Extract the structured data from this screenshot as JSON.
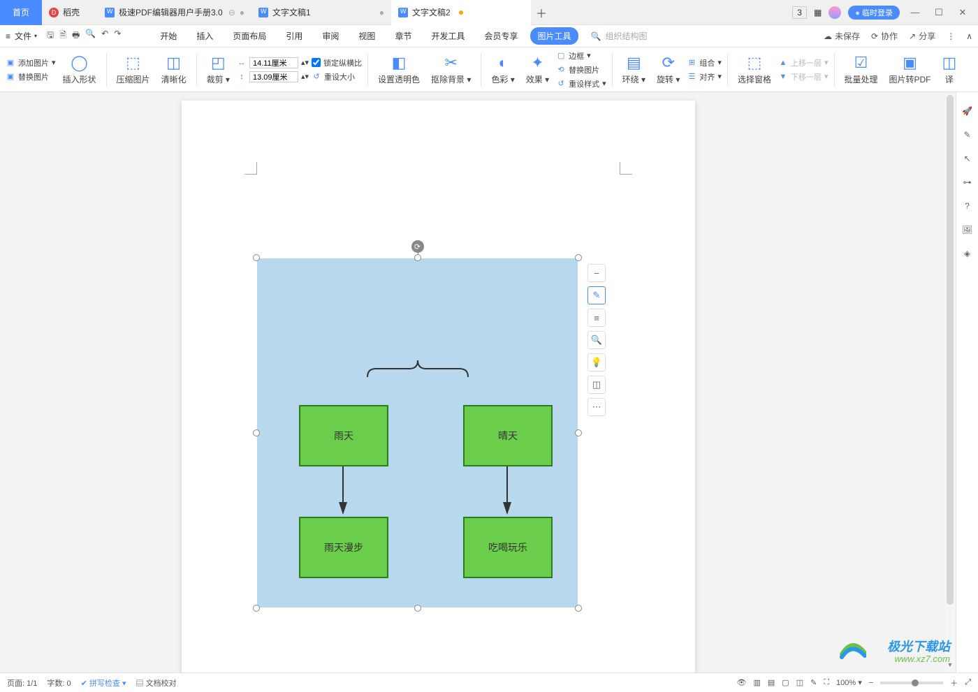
{
  "tabs": {
    "home": "首页",
    "dokke": "稻壳",
    "pdf_doc": "极速PDF编辑器用户手册3.0",
    "doc1": "文字文稿1",
    "doc2": "文字文稿2"
  },
  "title_right": {
    "login": "临时登录"
  },
  "menu": {
    "file": "文件",
    "tabs": {
      "start": "开始",
      "insert": "插入",
      "layout": "页面布局",
      "reference": "引用",
      "review": "审阅",
      "view": "视图",
      "chapter": "章节",
      "dev": "开发工具",
      "vip": "会员专享",
      "pictool": "图片工具"
    },
    "search_placeholder": "组织结构图",
    "unsaved": "未保存",
    "collab": "协作",
    "share": "分享"
  },
  "ribbon": {
    "add_image": "添加图片",
    "replace_image": "替换图片",
    "insert_shape": "插入形状",
    "compress": "压缩图片",
    "sharpen": "清晰化",
    "crop": "裁剪",
    "width": "14.11厘米",
    "height": "13.09厘米",
    "lock_ratio": "锁定纵横比",
    "reset_size": "重设大小",
    "set_transparent": "设置透明色",
    "remove_bg": "抠除背景",
    "color": "色彩",
    "effect": "效果",
    "border": "边框",
    "replace_pic": "替换图片",
    "reset_style": "重设样式",
    "wrap": "环绕",
    "rotate": "旋转",
    "group": "组合",
    "align": "对齐",
    "select_pane": "选择窗格",
    "move_up": "上移一层",
    "move_down": "下移一层",
    "batch": "批量处理",
    "to_pdf": "图片转PDF",
    "translate": "译"
  },
  "status": {
    "page": "页面: 1/1",
    "words": "字数: 0",
    "spell": "拼写检查",
    "proof": "文档校对",
    "zoom": "100%"
  },
  "watermark": {
    "line1": "极光下载站",
    "line2": "www.xz7.com"
  },
  "chart_data": {
    "type": "diagram",
    "nodes": [
      {
        "id": "rainy",
        "label": "雨天",
        "x": 0,
        "y": 0
      },
      {
        "id": "sunny",
        "label": "晴天",
        "x": 1,
        "y": 0
      },
      {
        "id": "walk",
        "label": "雨天漫步",
        "x": 0,
        "y": 1
      },
      {
        "id": "play",
        "label": "吃喝玩乐",
        "x": 1,
        "y": 1
      }
    ],
    "edges": [
      {
        "from": "bracket",
        "to": "rainy"
      },
      {
        "from": "bracket",
        "to": "sunny"
      },
      {
        "from": "rainy",
        "to": "walk"
      },
      {
        "from": "sunny",
        "to": "play"
      }
    ]
  },
  "diagram": {
    "rainy": "雨天",
    "sunny": "晴天",
    "walk": "雨天漫步",
    "play": "吃喝玩乐"
  }
}
